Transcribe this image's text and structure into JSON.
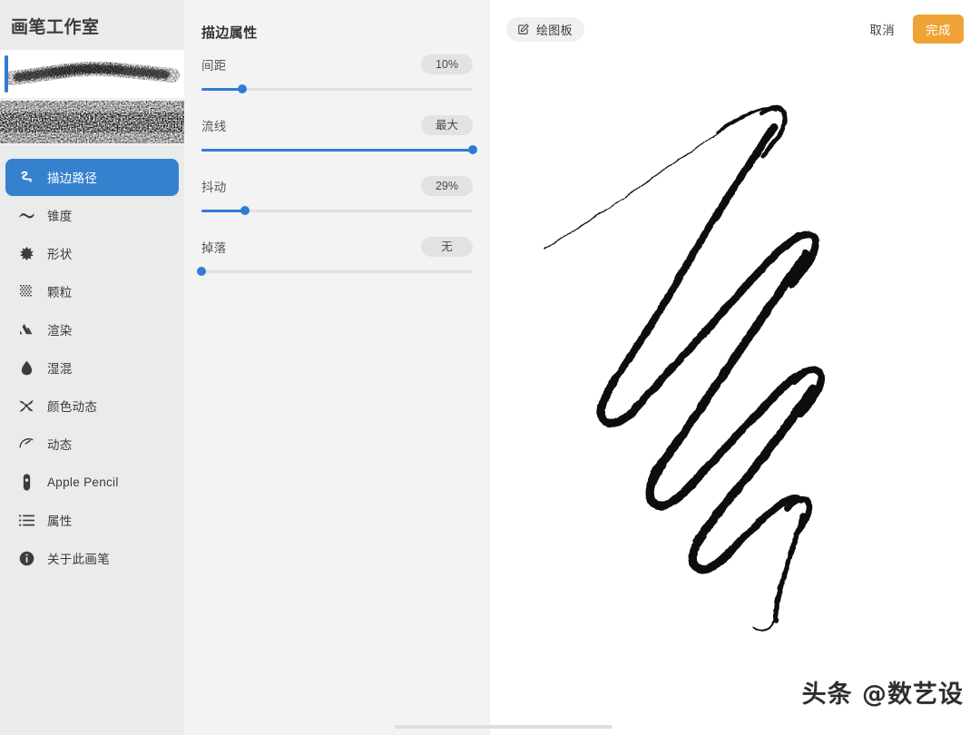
{
  "sidebar": {
    "title": "画笔工作室",
    "brush_previews": [
      {
        "name": "brush-preview-selected",
        "selected": true,
        "variant": "light"
      },
      {
        "name": "brush-preview-second",
        "selected": false,
        "variant": "dark"
      }
    ],
    "items": [
      {
        "label": "描边路径",
        "icon": "stroke-path-icon",
        "active": true
      },
      {
        "label": "锥度",
        "icon": "taper-icon",
        "active": false
      },
      {
        "label": "形状",
        "icon": "shape-icon",
        "active": false
      },
      {
        "label": "颗粒",
        "icon": "grain-icon",
        "active": false
      },
      {
        "label": "渲染",
        "icon": "rendering-icon",
        "active": false
      },
      {
        "label": "湿混",
        "icon": "wet-mix-icon",
        "active": false
      },
      {
        "label": "颜色动态",
        "icon": "color-dynamics-icon",
        "active": false
      },
      {
        "label": "动态",
        "icon": "dynamics-icon",
        "active": false
      },
      {
        "label": "Apple Pencil",
        "icon": "apple-pencil-icon",
        "active": false
      },
      {
        "label": "属性",
        "icon": "properties-list-icon",
        "active": false
      },
      {
        "label": "关于此画笔",
        "icon": "info-icon",
        "active": false
      }
    ]
  },
  "properties": {
    "title": "描边属性",
    "sliders": [
      {
        "label": "间距",
        "value": "10%",
        "percent": 15
      },
      {
        "label": "流线",
        "value": "最大",
        "percent": 100
      },
      {
        "label": "抖动",
        "value": "29%",
        "percent": 16
      },
      {
        "label": "掉落",
        "value": "无",
        "percent": 0
      }
    ]
  },
  "toolbar": {
    "drawpad_label": "绘图板",
    "cancel_label": "取消",
    "done_label": "完成",
    "done_color": "#efa336"
  },
  "canvas": {
    "watermark": "头条 @数艺设"
  },
  "colors": {
    "accent_blue": "#2f7dd1",
    "active_menu_blue": "#3581ce",
    "sidebar_bg": "#eaebeb",
    "panel_bg": "#f3f3f3",
    "canvas_bg": "#ffffff"
  }
}
